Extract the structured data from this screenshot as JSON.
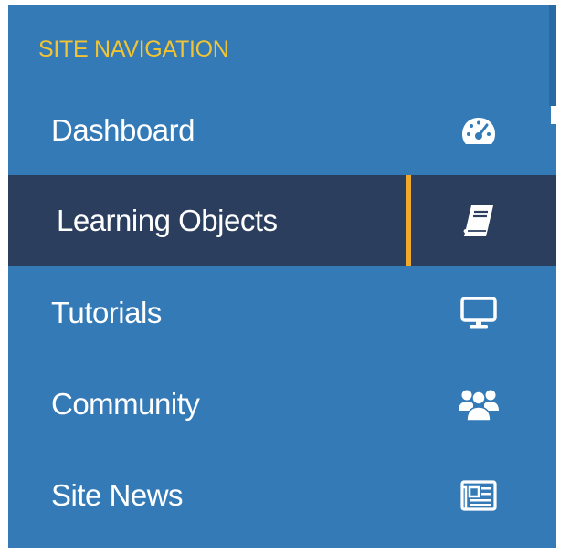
{
  "navigation": {
    "heading": "SITE NAVIGATION",
    "accent_color": "#f0c433",
    "active_marker_color": "#f0a92b",
    "background_color": "#337ab7",
    "active_background_color": "#2c3e5e",
    "items": [
      {
        "label": "Dashboard",
        "icon": "dashboard-gauge-icon",
        "active": false
      },
      {
        "label": "Learning Objects",
        "icon": "book-icon",
        "active": true
      },
      {
        "label": "Tutorials",
        "icon": "monitor-icon",
        "active": false
      },
      {
        "label": "Community",
        "icon": "users-icon",
        "active": false
      },
      {
        "label": "Site News",
        "icon": "newspaper-icon",
        "active": false
      }
    ]
  }
}
